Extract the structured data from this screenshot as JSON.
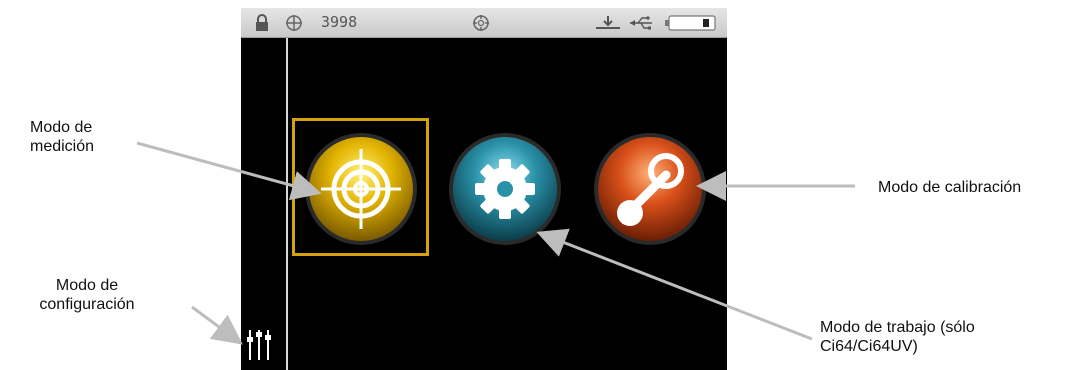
{
  "status_bar": {
    "lock_icon": "lock-icon",
    "target_icon": "crosshair-icon",
    "count": "3998",
    "center_icon": "aperture-icon",
    "usb_icon": "usb-icon",
    "battery_icon": "battery-icon"
  },
  "modes": [
    {
      "name": "measure",
      "icon": "target-icon",
      "color": "#e0b000"
    },
    {
      "name": "job",
      "icon": "gear-icon",
      "color": "#2a92a8"
    },
    {
      "name": "calibration",
      "icon": "calibration-icon",
      "color": "#d9501a"
    }
  ],
  "callouts": {
    "measure_line1": "Modo de",
    "measure_line2": "medición",
    "config_line1": "Modo de",
    "config_line2": "configuración",
    "calibration": "Modo de calibración",
    "job_line1": "Modo de trabajo (sólo",
    "job_line2": "Ci64/Ci64UV)"
  },
  "colors": {
    "selection": "#d4a20d",
    "screen_bg": "#000000",
    "arrow": "#bdbdbd"
  }
}
